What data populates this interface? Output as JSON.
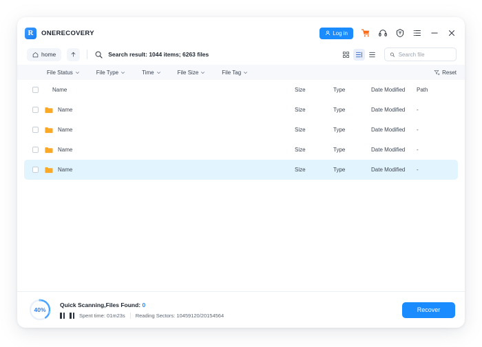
{
  "window": {
    "brand_name": "ONERECOVERY",
    "logo_letter": "R"
  },
  "titlebar": {
    "login_label": "Log in",
    "icons": [
      {
        "name": "cart-icon",
        "color": "#fa6a14"
      },
      {
        "name": "headset-icon",
        "color": "#2f3640"
      },
      {
        "name": "shield-icon",
        "color": "#2f3640"
      },
      {
        "name": "list-menu-icon",
        "color": "#2f3640"
      },
      {
        "name": "minimize-icon",
        "color": "#2f3640"
      },
      {
        "name": "close-icon",
        "color": "#2f3640"
      }
    ]
  },
  "toolbar": {
    "home_label": "home",
    "up_label": "↑",
    "search_result_text": "Search result: 1044 items; 6263 files",
    "views": [
      {
        "name": "grid-view",
        "active": false
      },
      {
        "name": "detail-view",
        "active": true
      },
      {
        "name": "list-view",
        "active": false
      }
    ],
    "search_placeholder": "Search file",
    "search_value": ""
  },
  "filterbar": {
    "items": [
      {
        "label": "File Status"
      },
      {
        "label": "File Type"
      },
      {
        "label": "Time"
      },
      {
        "label": "File Size"
      },
      {
        "label": "File Tag"
      }
    ],
    "reset_label": "Reset"
  },
  "table": {
    "columns": {
      "name": "Name",
      "size": "Size",
      "type": "Type",
      "date": "Date Modified",
      "path": "Path"
    },
    "rows": [
      {
        "name": "Name",
        "size": "Size",
        "type": "Type",
        "date": "Date Modified",
        "path": "-",
        "selected": false
      },
      {
        "name": "Name",
        "size": "Size",
        "type": "Type",
        "date": "Date Modified",
        "path": "-",
        "selected": false
      },
      {
        "name": "Name",
        "size": "Size",
        "type": "Type",
        "date": "Date Modified",
        "path": "-",
        "selected": false
      },
      {
        "name": "Name",
        "size": "Size",
        "type": "Type",
        "date": "Date Modified",
        "path": "-",
        "selected": true
      }
    ]
  },
  "status": {
    "progress_percent": 40,
    "progress_label": "40%",
    "scan_title": "Quick Scanning,Files Found:",
    "files_found": "0",
    "spent_time": "Spent time: 01m23s",
    "reading_sectors": "Reading Sectors: 10459120/20154564",
    "recover_label": "Recover"
  },
  "colors": {
    "accent": "#1a8cff",
    "orange": "#fa6a14",
    "folder": "#f9a926",
    "row_selected": "#e2f4fd",
    "filterbar_bg": "#f6f8fc"
  }
}
